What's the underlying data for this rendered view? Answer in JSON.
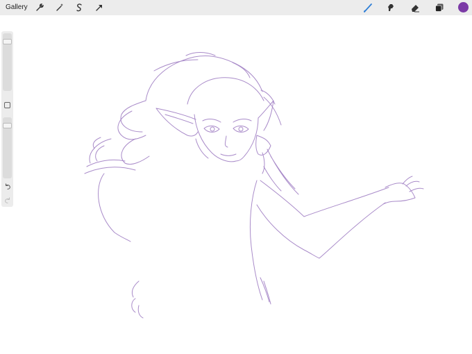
{
  "topbar": {
    "gallery_label": "Gallery",
    "left_tools": [
      "wrench-icon",
      "magic-wand-icon",
      "selection-icon",
      "transform-arrow-icon"
    ],
    "right_tools": [
      "brush-icon",
      "smudge-icon",
      "eraser-icon",
      "layers-icon"
    ]
  },
  "sidebar": {
    "brush_size_level": 0.1,
    "opacity_level": 0.1,
    "icons": [
      "modify-square-icon",
      "undo-icon",
      "redo-icon"
    ]
  },
  "colors": {
    "active_color": "#7b3aa6",
    "brush_blue": "#2f7fd6",
    "toolbar_bg": "#ececec",
    "sketch_stroke": "#a98bc9"
  }
}
